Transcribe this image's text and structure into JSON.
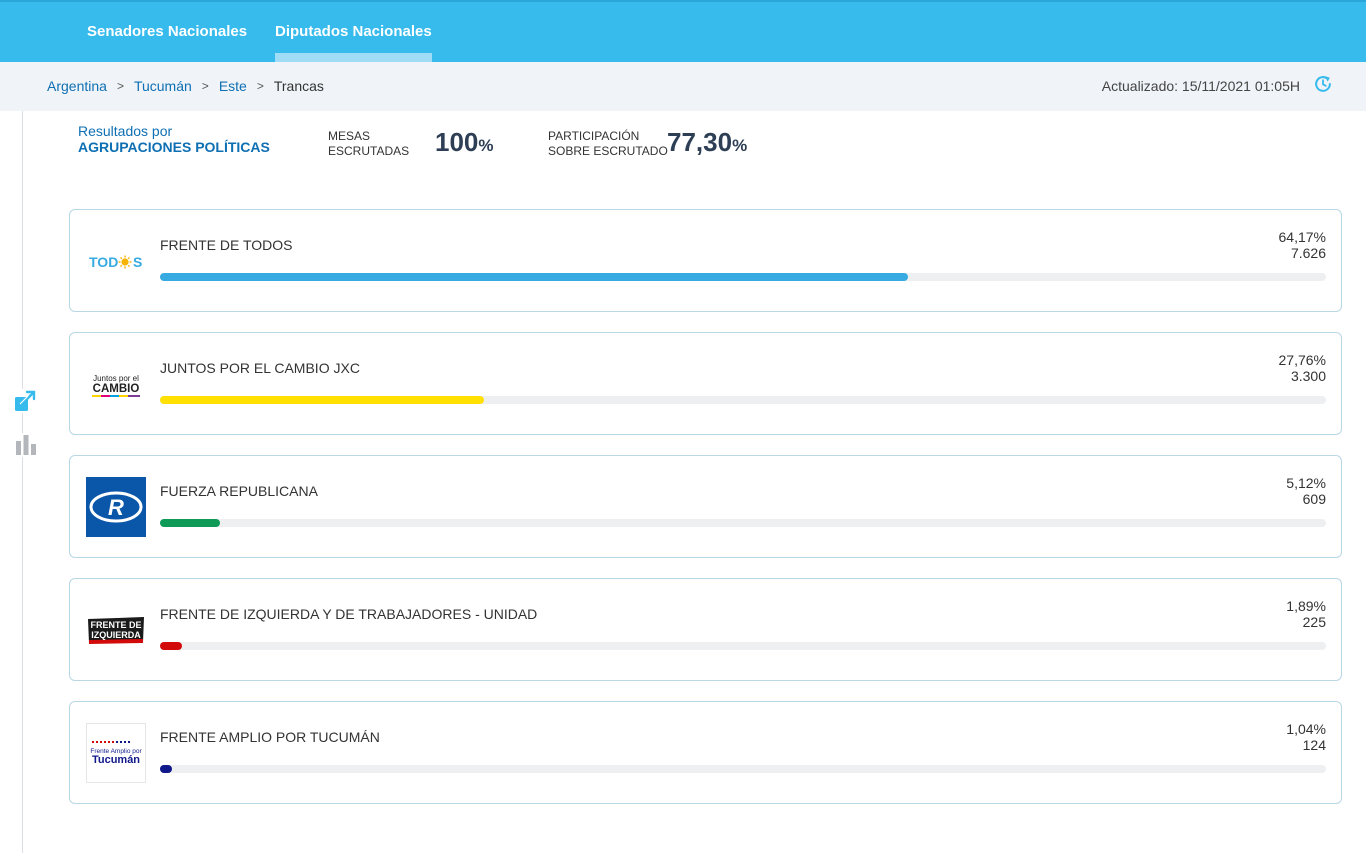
{
  "nav": {
    "tabs": [
      {
        "label": "Senadores Nacionales",
        "active": false
      },
      {
        "label": "Diputados Nacionales",
        "active": true
      }
    ]
  },
  "breadcrumb": {
    "items": [
      "Argentina",
      "Tucumán",
      "Este"
    ],
    "separator": ">",
    "current": "Trancas"
  },
  "updated": "Actualizado: 15/11/2021 01:05H",
  "summary": {
    "title_line1": "Resultados por",
    "title_line2": "AGRUPACIONES POLÍTICAS",
    "mesas_line1": "MESAS",
    "mesas_line2": "ESCRUTADAS",
    "mesas_value": "100",
    "mesas_unit": "%",
    "part_line1": "PARTICIPACIÓN",
    "part_line2": "SOBRE ESCRUTADO",
    "part_value": "77,30",
    "part_unit": "%"
  },
  "parties": [
    {
      "name": "FRENTE DE TODOS",
      "percent": "64,17%",
      "votes": "7.626",
      "share": 64.17,
      "color": "#37aae1",
      "logo": "todos-logo"
    },
    {
      "name": "JUNTOS POR EL CAMBIO JXC",
      "percent": "27,76%",
      "votes": "3.300",
      "share": 27.76,
      "color": "#ffe000",
      "logo": "juntos-por-el-cambio-logo"
    },
    {
      "name": "FUERZA REPUBLICANA",
      "percent": "5,12%",
      "votes": "609",
      "share": 5.12,
      "color": "#0f9a58",
      "logo": "fuerza-republicana-logo"
    },
    {
      "name": "FRENTE DE IZQUIERDA Y DE TRABAJADORES - UNIDAD",
      "percent": "1,89%",
      "votes": "225",
      "share": 1.89,
      "color": "#d20a0a",
      "logo": "frente-de-izquierda-logo"
    },
    {
      "name": "FRENTE AMPLIO POR TUCUMÁN",
      "percent": "1,04%",
      "votes": "124",
      "share": 1.04,
      "color": "#10188a",
      "logo": "frente-amplio-logo"
    }
  ],
  "logo_text": {
    "todos": [
      "TOD",
      "S"
    ],
    "juntos": [
      "Juntos por el",
      "CAMBIO"
    ],
    "fuerza": "R",
    "izquierda": [
      "FRENTE DE",
      "IZQUIERDA"
    ],
    "amplio": [
      "Frente Amplio por",
      "Tucumán"
    ]
  },
  "colors": {
    "nav": "#37bbed",
    "link": "#0e6fb3",
    "card_border": "#b9d7e4"
  },
  "icons": [
    "refresh-icon",
    "share-icon",
    "bar-chart-icon"
  ]
}
